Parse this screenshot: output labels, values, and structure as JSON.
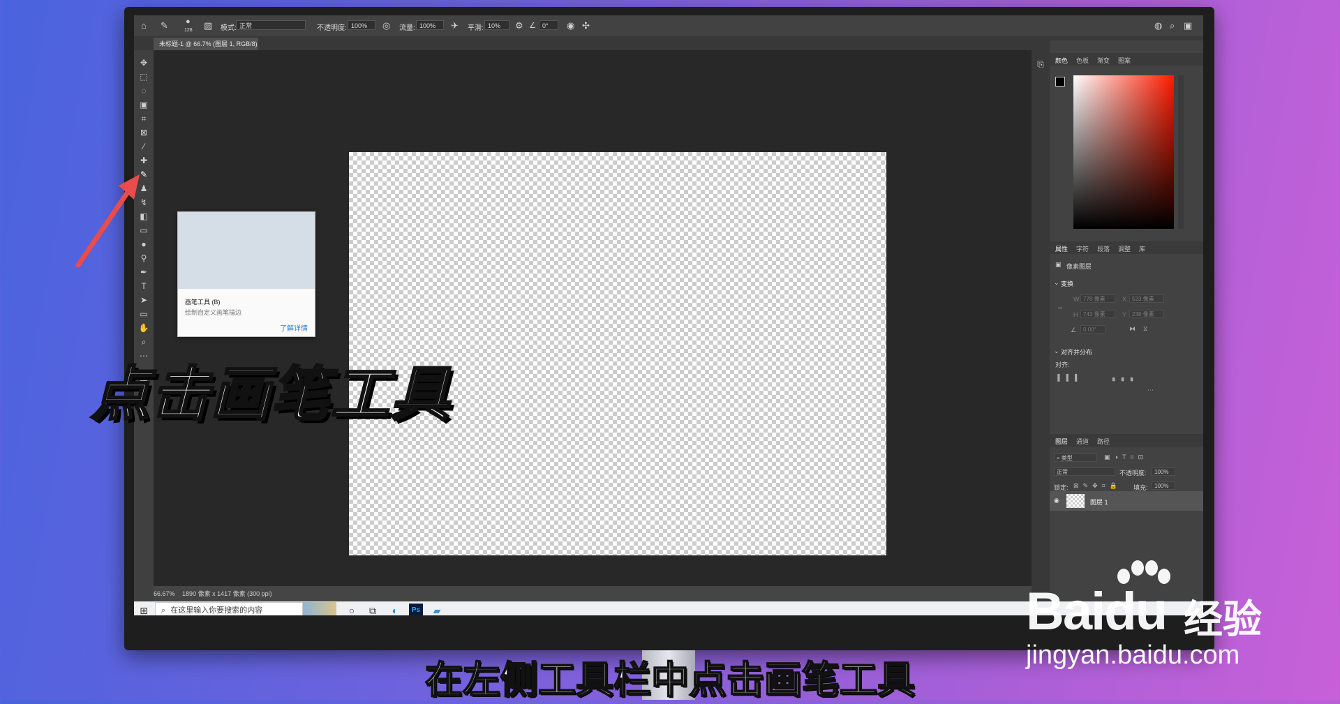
{
  "options_bar": {
    "brush_size": "128",
    "mode_label": "模式:",
    "mode_value": "正常",
    "opacity_label": "不透明度:",
    "opacity_value": "100%",
    "flow_label": "流量:",
    "flow_value": "100%",
    "smooth_label": "平滑:",
    "smooth_value": "10%",
    "angle_value": "0°"
  },
  "document_tab": {
    "title": "未标题-1 @ 66.7% (图层 1, RGB/8) *",
    "close": "×"
  },
  "tooltip": {
    "title": "画笔工具 (B)",
    "description": "绘制自定义画笔描边",
    "learn_more": "了解详情"
  },
  "status_bar": {
    "zoom": "66.67%",
    "doc_info": "1890 像素 x 1417 像素 (300 ppi)"
  },
  "panels": {
    "color_tabs": [
      "颜色",
      "色板",
      "渐变",
      "图案"
    ],
    "properties_tabs": [
      "属性",
      "字符",
      "段落",
      "调整",
      "库"
    ],
    "pixel_layer": "像素图层",
    "transform": "变换",
    "w_label": "W",
    "w_value": "778 像素",
    "x_label": "X",
    "x_value": "523 像素",
    "h_label": "H",
    "h_value": "743 像素",
    "y_label": "Y",
    "y_value": "238 像素",
    "angle_value": "0.00°",
    "align_distribute": "对齐并分布",
    "align_label": "对齐:",
    "layers_tabs": [
      "图层",
      "通道",
      "路径"
    ],
    "kind_label": "类型",
    "blend_mode": "正常",
    "opacity_label": "不透明度:",
    "opacity_value": "100%",
    "lock_label": "锁定:",
    "fill_label": "填充:",
    "fill_value": "100%",
    "layer_name": "图层 1"
  },
  "taskbar": {
    "search_placeholder": "在这里输入你要搜索的内容"
  },
  "overlay": {
    "big_caption": "点击画笔工具",
    "subtitle": "在左侧工具栏中点击画笔工具"
  },
  "watermark": {
    "brand": "Baidu",
    "brand_cn": "经验",
    "url": "jingyan.baidu.com"
  },
  "colors": {
    "accent_red": "#e84c4c",
    "ps_blue": "#2c7ad6",
    "background_left": "#4a63de",
    "background_right": "#c860d8"
  }
}
